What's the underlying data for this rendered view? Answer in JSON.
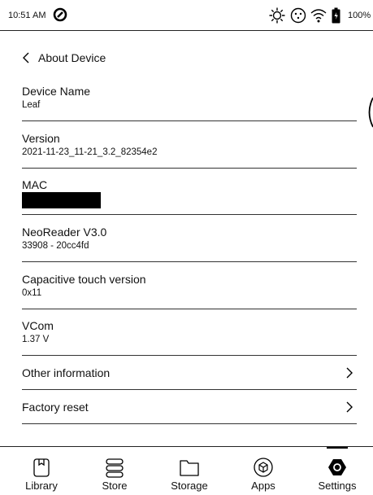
{
  "status_bar": {
    "time": "10:51 AM",
    "battery_percent": "100%",
    "icons": [
      "app-notification-icon",
      "brightness-icon",
      "refresh-icon",
      "wifi-icon",
      "battery-icon"
    ]
  },
  "header": {
    "title": "About Device"
  },
  "rows": [
    {
      "title": "Device Name",
      "value": "Leaf"
    },
    {
      "title": "Version",
      "value": "2021-11-23_11-21_3.2_82354e2"
    },
    {
      "title": "MAC",
      "value": ""
    },
    {
      "title": "NeoReader V3.0",
      "value": "33908 - 20cc4fd"
    },
    {
      "title": "Capacitive touch version",
      "value": "0x11"
    },
    {
      "title": "VCom",
      "value": "1.37 V"
    }
  ],
  "nav_rows": [
    {
      "title": "Other information"
    },
    {
      "title": "Factory reset"
    }
  ],
  "tabs": [
    {
      "label": "Library",
      "icon": "library-icon"
    },
    {
      "label": "Store",
      "icon": "store-icon"
    },
    {
      "label": "Storage",
      "icon": "folder-icon"
    },
    {
      "label": "Apps",
      "icon": "apps-icon"
    },
    {
      "label": "Settings",
      "icon": "settings-icon"
    }
  ],
  "active_tab": "Settings"
}
